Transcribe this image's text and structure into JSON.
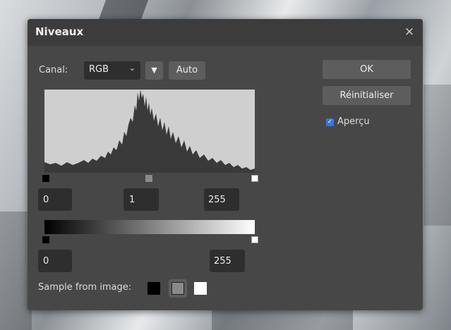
{
  "dialog": {
    "title": "Niveaux",
    "close_glyph": "×"
  },
  "channel": {
    "label": "Canal:",
    "selected": "RGB",
    "chevron_glyph": "⌄",
    "menu_glyph": "▼"
  },
  "buttons": {
    "auto": "Auto",
    "ok": "OK",
    "reset": "Réinitialiser"
  },
  "preview": {
    "label": "Aperçu",
    "checked": true,
    "check_glyph": "✓"
  },
  "input_levels": {
    "black": "0",
    "gamma": "1",
    "white": "255"
  },
  "output_levels": {
    "black": "0",
    "white": "255"
  },
  "sample": {
    "label": "Sample from image:"
  },
  "colors": {
    "dialog_bg": "#474747",
    "histogram_bg": "#cfcfcf",
    "histogram_fill": "#3a3a3a",
    "accent_check": "#2f79e6"
  },
  "icons": {
    "close": "close-icon",
    "chevron": "chevron-down-icon",
    "menu": "triangle-down-icon",
    "check": "checkmark-icon",
    "eyedropper_black": "black-eyedropper-icon",
    "eyedropper_gray": "gray-eyedropper-icon",
    "eyedropper_white": "white-eyedropper-icon"
  }
}
